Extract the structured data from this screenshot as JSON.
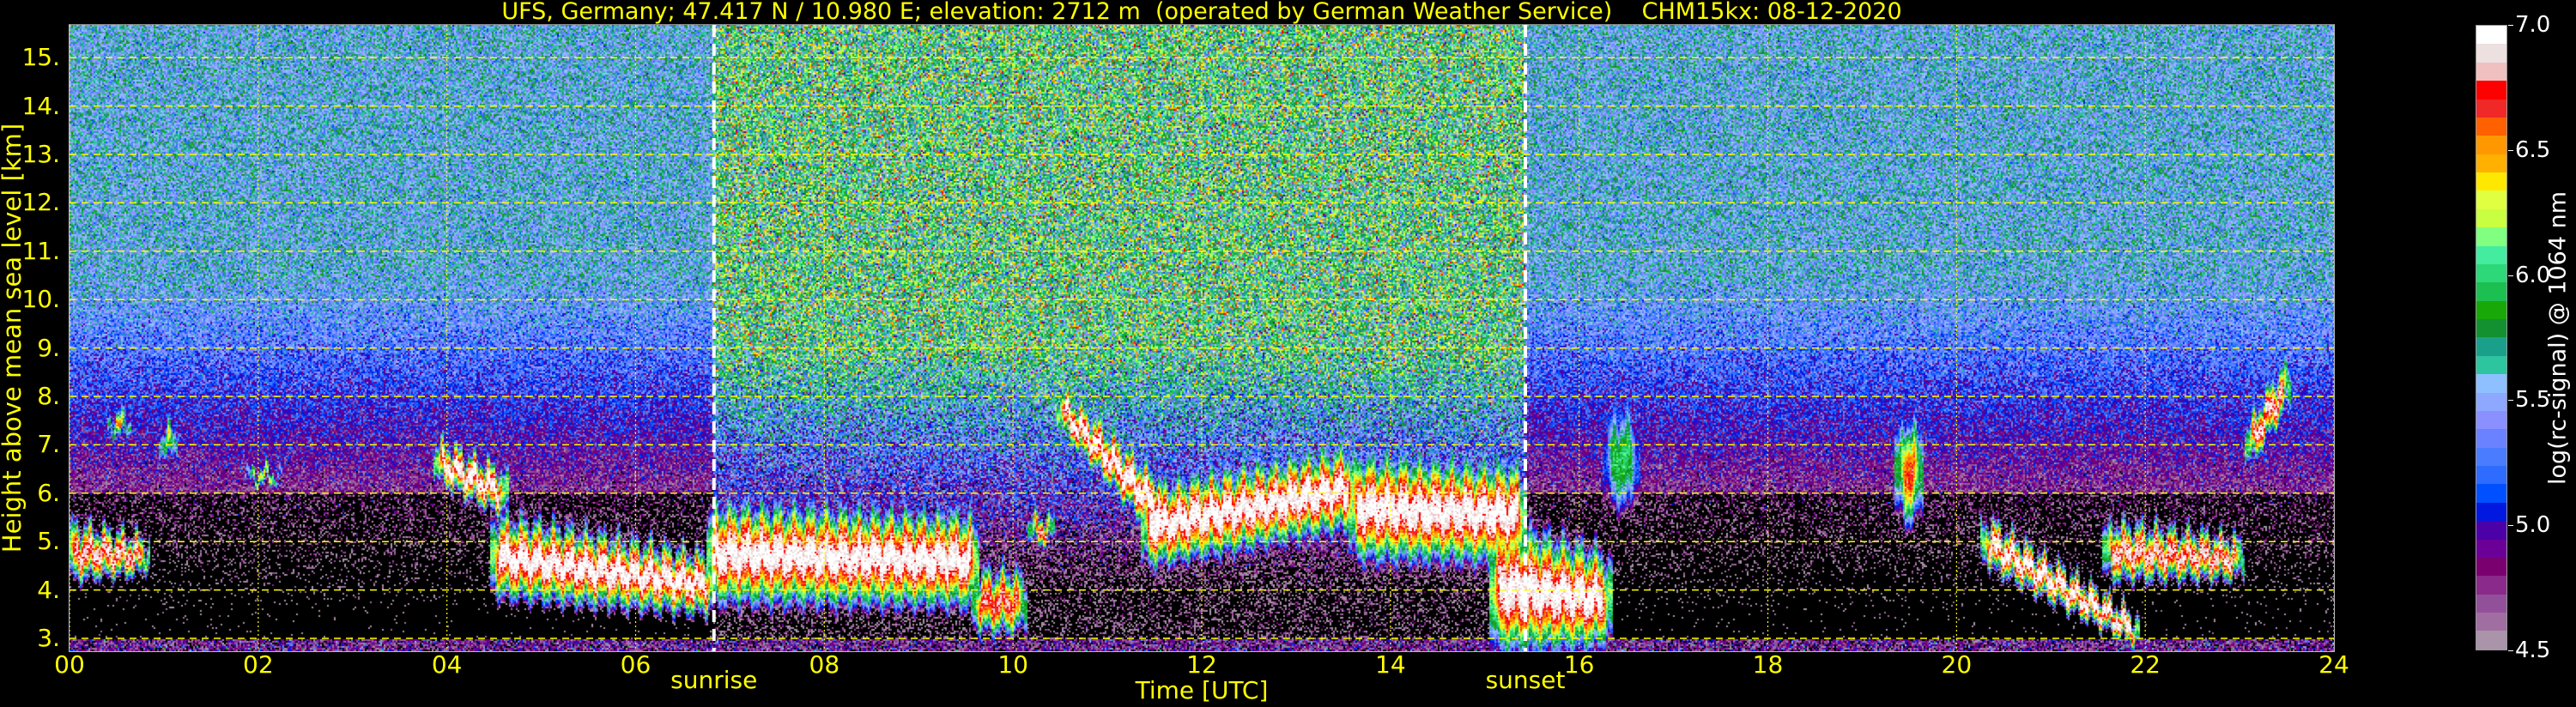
{
  "chart_data": {
    "type": "heatmap",
    "title": "UFS, Germany; 47.417 N / 10.980 E; elevation: 2712 m  (operated by German Weather Service)    CHM15kx: 08-12-2020",
    "xlabel": "Time [UTC]",
    "ylabel": "Height above mean sea level [km]",
    "xlim": [
      0,
      24
    ],
    "ylim": [
      2.75,
      15.7
    ],
    "xticks": [
      0,
      2,
      4,
      6,
      8,
      10,
      12,
      14,
      16,
      18,
      20,
      22,
      24
    ],
    "xtick_labels": [
      "00",
      "02",
      "04",
      "06",
      "08",
      "10",
      "12",
      "14",
      "16",
      "18",
      "20",
      "22",
      "24"
    ],
    "yticks": [
      3,
      4,
      5,
      6,
      7,
      8,
      9,
      10,
      11,
      12,
      13,
      14,
      15
    ],
    "ytick_labels": [
      "3.",
      "4.",
      "5.",
      "6.",
      "7.",
      "8.",
      "9.",
      "10.",
      "11.",
      "12.",
      "13.",
      "14.",
      "15."
    ],
    "grid": true,
    "annotations": [
      {
        "label": "sunrise",
        "x": 6.83
      },
      {
        "label": "sunset",
        "x": 15.43
      }
    ],
    "colorbar": {
      "label": "log(rc-signal) @ 1064 nm",
      "range": [
        4.5,
        7.0
      ],
      "ticks": [
        4.5,
        5.0,
        5.5,
        6.0,
        6.5,
        7.0
      ],
      "tick_labels": [
        "4.5",
        "5.0",
        "5.5",
        "6.0",
        "6.5",
        "7.0"
      ],
      "colors": [
        "#a994a9",
        "#a06ea0",
        "#93509a",
        "#8a2a8a",
        "#7a0070",
        "#6a0098",
        "#4b00a8",
        "#0018e0",
        "#0050ff",
        "#2e6cff",
        "#4a7cff",
        "#6a82ff",
        "#8a90ff",
        "#8ea8ff",
        "#8ec0ff",
        "#2dc4a0",
        "#1aa08a",
        "#139030",
        "#18a808",
        "#1cc050",
        "#2cd878",
        "#44eca0",
        "#80ff80",
        "#c8ff40",
        "#e0ff40",
        "#ffe800",
        "#ffb000",
        "#ff9800",
        "#ff6000",
        "#f02828",
        "#ff0000",
        "#f0c0c0",
        "#ece0e0",
        "#ffffff"
      ]
    },
    "cloud_layers": [
      {
        "t": [
          0.0,
          0.8
        ],
        "base": [
          4.3,
          4.4
        ],
        "top": [
          5.3,
          5.0
        ],
        "peak": 6.9
      },
      {
        "t": [
          0.45,
          0.6
        ],
        "base": [
          7.2,
          7.2
        ],
        "top": [
          7.6,
          7.6
        ],
        "peak": 6.6
      },
      {
        "t": [
          1.0,
          1.1
        ],
        "base": [
          6.7,
          6.7
        ],
        "top": [
          7.4,
          7.4
        ],
        "peak": 6.5
      },
      {
        "t": [
          1.9,
          2.2
        ],
        "base": [
          6.2,
          6.2
        ],
        "top": [
          6.5,
          6.5
        ],
        "peak": 6.3
      },
      {
        "t": [
          3.9,
          4.6
        ],
        "base": [
          6.3,
          5.6
        ],
        "top": [
          7.0,
          6.4
        ],
        "peak": 7.0
      },
      {
        "t": [
          4.5,
          6.8
        ],
        "base": [
          4.0,
          3.6
        ],
        "top": [
          5.4,
          4.6
        ],
        "peak": 7.0
      },
      {
        "t": [
          6.8,
          9.6
        ],
        "base": [
          3.9,
          3.8
        ],
        "top": [
          5.6,
          5.4
        ],
        "peak": 7.0
      },
      {
        "t": [
          9.6,
          10.1
        ],
        "base": [
          3.2,
          3.2
        ],
        "top": [
          4.3,
          4.3
        ],
        "peak": 6.8
      },
      {
        "t": [
          10.2,
          10.4
        ],
        "base": [
          5.0,
          5.0
        ],
        "top": [
          5.5,
          5.5
        ],
        "peak": 6.8
      },
      {
        "t": [
          10.5,
          11.6
        ],
        "base": [
          7.4,
          5.0
        ],
        "top": [
          8.1,
          6.1
        ],
        "peak": 7.0
      },
      {
        "t": [
          11.4,
          13.6
        ],
        "base": [
          4.6,
          5.4
        ],
        "top": [
          6.0,
          6.8
        ],
        "peak": 7.0
      },
      {
        "t": [
          13.6,
          15.4
        ],
        "base": [
          4.8,
          4.7
        ],
        "top": [
          6.6,
          6.4
        ],
        "peak": 7.0
      },
      {
        "t": [
          15.1,
          16.3
        ],
        "base": [
          2.9,
          3.0
        ],
        "top": [
          5.2,
          4.6
        ],
        "peak": 7.0
      },
      {
        "t": [
          16.3,
          16.6
        ],
        "base": [
          5.6,
          5.6
        ],
        "top": [
          7.8,
          7.8
        ],
        "peak": 6.0
      },
      {
        "t": [
          19.4,
          19.6
        ],
        "base": [
          5.5,
          5.5
        ],
        "top": [
          7.4,
          7.4
        ],
        "peak": 6.7
      },
      {
        "t": [
          20.3,
          21.9
        ],
        "base": [
          4.6,
          2.9
        ],
        "top": [
          5.4,
          3.4
        ],
        "peak": 7.0
      },
      {
        "t": [
          21.6,
          23.0
        ],
        "base": [
          4.3,
          4.3
        ],
        "top": [
          5.3,
          5.0
        ],
        "peak": 6.9
      },
      {
        "t": [
          23.1,
          23.5
        ],
        "base": [
          6.6,
          7.8
        ],
        "top": [
          7.4,
          8.7
        ],
        "peak": 6.9
      }
    ]
  }
}
